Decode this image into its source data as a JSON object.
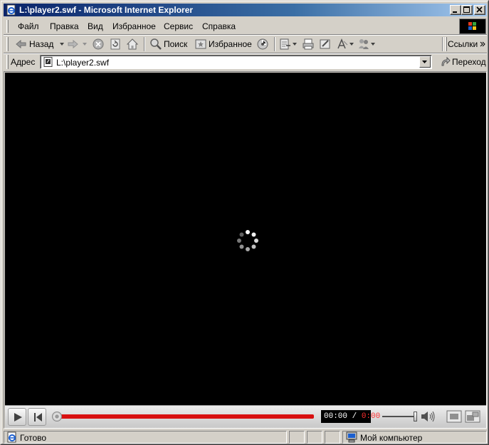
{
  "window": {
    "title": "L:\\player2.swf - Microsoft Internet Explorer",
    "title_bar_color": "#0a246a"
  },
  "menu": {
    "items": [
      {
        "label": "Файл"
      },
      {
        "label": "Правка"
      },
      {
        "label": "Вид"
      },
      {
        "label": "Избранное"
      },
      {
        "label": "Сервис"
      },
      {
        "label": "Справка"
      }
    ]
  },
  "toolbar": {
    "back_label": "Назад",
    "search_label": "Поиск",
    "favorites_label": "Избранное",
    "links_label": "Ссылки",
    "icons": [
      "back-arrow-icon",
      "forward-arrow-icon",
      "stop-icon",
      "refresh-icon",
      "home-icon",
      "search-icon",
      "favorites-icon",
      "media-icon",
      "history-icon",
      "print-icon",
      "edit-icon",
      "font-icon",
      "messenger-icon"
    ]
  },
  "address": {
    "label": "Адрес",
    "value": "L:\\player2.swf",
    "go_label": "Переход"
  },
  "player": {
    "current_time": "00:00 /",
    "total_time": "0:00",
    "progress_fraction": 0.0,
    "volume_fraction": 1.0,
    "progress_color": "#d81010",
    "background_color": "#000000"
  },
  "status": {
    "text": "Готово",
    "zone": "Мой компьютер"
  }
}
